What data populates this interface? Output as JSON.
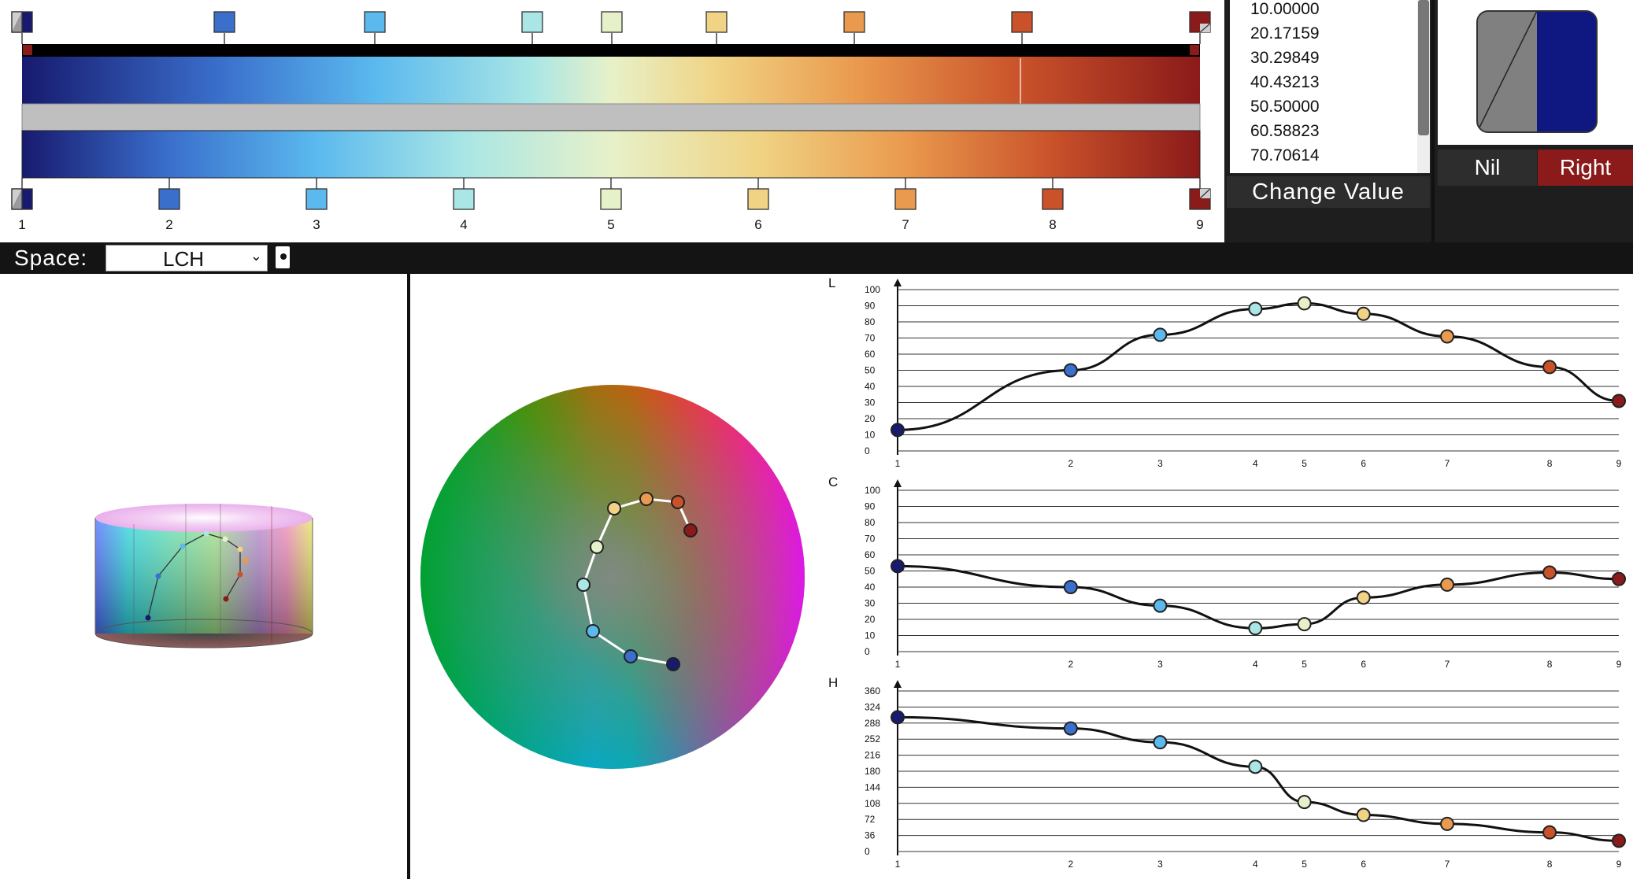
{
  "colors": [
    "#171a6e",
    "#3a6fcc",
    "#5bb9ee",
    "#a9e6e5",
    "#e7f1c9",
    "#f0d384",
    "#ea9a4e",
    "#c9522a",
    "#8b1a1a"
  ],
  "values": {
    "items": [
      "10.00000",
      "20.17159",
      "30.29849",
      "40.43213",
      "50.50000",
      "60.58823",
      "70.70614"
    ],
    "change_label": "Change Value"
  },
  "swatch": {
    "left_color": "#808080",
    "right_color": "#0f1780"
  },
  "mode_buttons": {
    "nil": "Nil",
    "right": "Right"
  },
  "ramp": {
    "stop_numbers": [
      "1",
      "2",
      "3",
      "4",
      "5",
      "6",
      "7",
      "8",
      "9"
    ]
  },
  "space": {
    "label": "Space:",
    "selected": "LCH"
  },
  "graphs": {
    "L": {
      "title": "L",
      "ticks": [
        "100",
        "90",
        "80",
        "70",
        "60",
        "50",
        "40",
        "30",
        "20",
        "10",
        "0"
      ],
      "xticks": [
        "1",
        "2",
        "3",
        "4",
        "5",
        "6",
        "7",
        "8",
        "9"
      ],
      "max": 100,
      "values": [
        13,
        50,
        72,
        88,
        91.5,
        85,
        71,
        52,
        31
      ],
      "xpos": [
        1,
        2,
        3,
        4,
        4.5,
        5,
        6,
        7,
        9
      ]
    },
    "C": {
      "title": "C",
      "ticks": [
        "100",
        "90",
        "80",
        "70",
        "60",
        "50",
        "40",
        "30",
        "20",
        "10",
        "0"
      ],
      "xticks": [
        "1",
        "2",
        "3",
        "4",
        "5",
        "6",
        "7",
        "8",
        "9"
      ],
      "max": 100,
      "values": [
        53,
        40,
        28.5,
        14.5,
        17,
        33.5,
        41.5,
        49,
        45
      ],
      "xpos": [
        1,
        2,
        3,
        4,
        4.5,
        5,
        6,
        7,
        9
      ]
    },
    "H": {
      "title": "H",
      "ticks": [
        "360",
        "324",
        "288",
        "252",
        "216",
        "180",
        "144",
        "108",
        "72",
        "36",
        "0"
      ],
      "xticks": [
        "1",
        "2",
        "3",
        "4",
        "5",
        "6",
        "7",
        "8",
        "9"
      ],
      "max": 360,
      "values": [
        301,
        276,
        245,
        190,
        111,
        82,
        62,
        43,
        24
      ],
      "xpos": [
        1,
        2,
        3,
        4,
        4.5,
        5,
        6,
        7,
        9
      ]
    }
  }
}
